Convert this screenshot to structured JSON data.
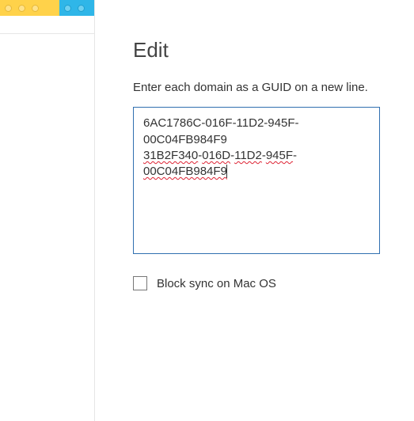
{
  "panel": {
    "title": "Edit",
    "instruction": "Enter each domain as a GUID on a new line.",
    "guid_lines": [
      {
        "segments": [
          {
            "text": "6AC1786C-016F-11D2-945F-",
            "spellcheck": false
          }
        ]
      },
      {
        "segments": [
          {
            "text": "00C04FB984F9",
            "spellcheck": false
          }
        ]
      },
      {
        "segments": [
          {
            "text": "31B2F340",
            "spellcheck": true
          },
          {
            "text": "-",
            "spellcheck": false
          },
          {
            "text": "016D",
            "spellcheck": true
          },
          {
            "text": "-",
            "spellcheck": false
          },
          {
            "text": "11D2",
            "spellcheck": true
          },
          {
            "text": "-",
            "spellcheck": false
          },
          {
            "text": "945F",
            "spellcheck": true
          },
          {
            "text": "-",
            "spellcheck": false
          }
        ]
      },
      {
        "segments": [
          {
            "text": "00C04FB984F9",
            "spellcheck": true
          }
        ],
        "caret_after": true
      }
    ],
    "checkbox": {
      "label": "Block sync on Mac OS",
      "checked": false
    }
  },
  "colors": {
    "focus_border": "#2f6fb0",
    "lego_yellow": "#ffd24a",
    "lego_blue": "#2fb6e8"
  }
}
